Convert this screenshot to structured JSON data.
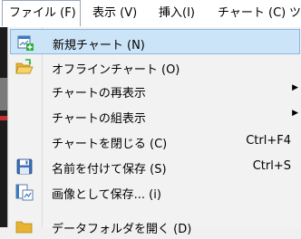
{
  "menubar": {
    "items": [
      {
        "label": "ファイル (F)"
      },
      {
        "label": "表示 (V)"
      },
      {
        "label": "挿入(I)"
      },
      {
        "label": "チャート (C)"
      },
      {
        "label": "ツ"
      }
    ]
  },
  "menu": {
    "items": [
      {
        "label": "新規チャート (N)",
        "icon": "new-chart-icon"
      },
      {
        "label": "オフラインチャート (O)",
        "icon": "open-folder-icon"
      },
      {
        "label": "チャートの再表示",
        "submenu": "▶"
      },
      {
        "label": "チャートの組表示",
        "submenu": "▶"
      },
      {
        "label": "チャートを閉じる (C)",
        "shortcut": "Ctrl+F4"
      },
      {
        "label": "名前を付けて保存 (S)",
        "shortcut": "Ctrl+S",
        "icon": "save-icon"
      },
      {
        "label": "画像として保存... (i)",
        "icon": "save-picture-icon"
      },
      {
        "label": "データフォルダを開く (D)",
        "icon": "folder-icon"
      }
    ]
  },
  "colors": {
    "highlight": "#cce4f7",
    "highlight_border": "#89b8e0",
    "menu_bg": "#f2f2f2"
  }
}
